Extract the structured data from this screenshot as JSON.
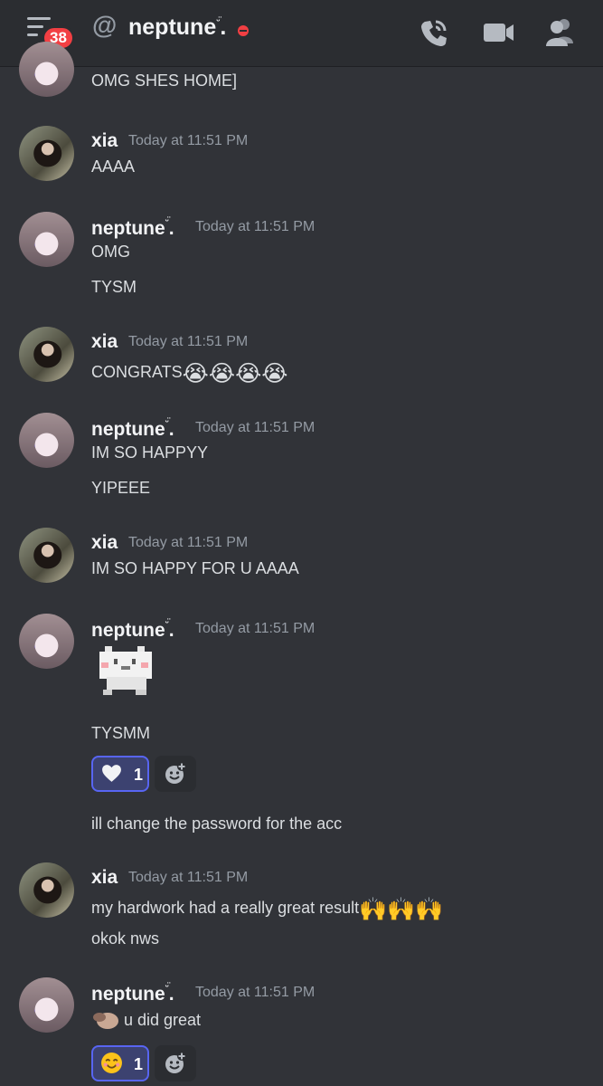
{
  "header": {
    "notification_count": "38",
    "channel_name": "neptune",
    "name_suffix": "ᵕ̈",
    "name_dot": ".",
    "at_symbol": "@"
  },
  "messages": [
    {
      "author": "",
      "time": "",
      "lines": [
        "OMG SHES HOME]"
      ]
    },
    {
      "author": "xia",
      "time": "Today at 11:51 PM",
      "lines": [
        "AAAA"
      ]
    },
    {
      "author": "neptune",
      "time": "Today at 11:51 PM",
      "lines": [
        "OMG",
        "TYSM"
      ]
    },
    {
      "author": "xia",
      "time": "Today at 11:51 PM",
      "lines": [
        "CONGRATS"
      ],
      "emoji": "😭😭😭😭"
    },
    {
      "author": "neptune",
      "time": "Today at 11:51 PM",
      "lines": [
        "IM SO HAPPYY",
        "YIPEEE"
      ]
    },
    {
      "author": "xia",
      "time": "Today at 11:51 PM",
      "lines": [
        "IM SO HAPPY FOR U AAAA"
      ]
    },
    {
      "author": "neptune",
      "time": "Today at 11:51 PM",
      "lines": [
        "TYSMM",
        "ill change the password for the acc"
      ],
      "reaction": {
        "emoji": "heart",
        "count": "1"
      }
    },
    {
      "author": "xia",
      "time": "Today at 11:51 PM",
      "lines": [
        "my hardwork had a really great result",
        "okok nws"
      ],
      "emoji": "🙌🙌🙌"
    },
    {
      "author": "neptune",
      "time": "Today at 11:51 PM",
      "lines": [
        "u did great"
      ],
      "reaction": {
        "emoji": "blush",
        "count": "1"
      }
    }
  ],
  "icons": [
    "hamburger-icon",
    "at-icon",
    "phone-call-icon",
    "video-icon",
    "members-icon",
    "heart-icon",
    "add-reaction-icon",
    "smile-icon"
  ],
  "colors": {
    "background": "#313338",
    "header": "#2b2d31",
    "accent": "#5865f2",
    "badge": "#f23f43",
    "muted": "#949ba4"
  }
}
